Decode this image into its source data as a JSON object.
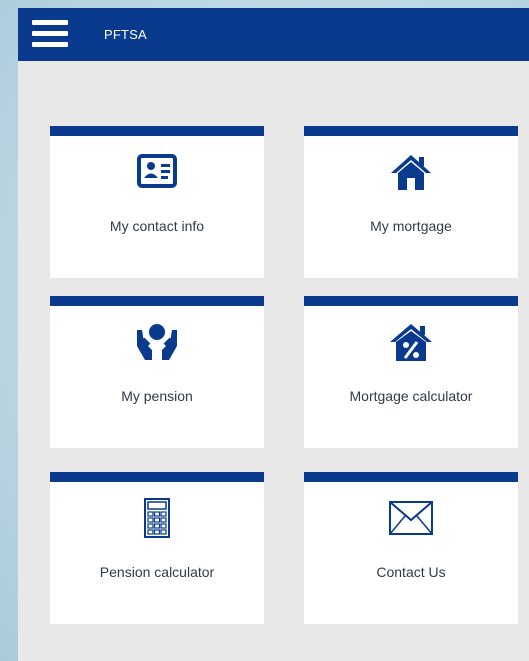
{
  "header": {
    "title": "PFTSA",
    "menu_icon": "hamburger-menu-icon"
  },
  "colors": {
    "brand": "#0a3a8e",
    "background": "#e8e8e8",
    "tile": "#ffffff",
    "text": "#333a44"
  },
  "tiles": [
    {
      "label": "My contact info",
      "icon": "contact-card-icon"
    },
    {
      "label": "My mortgage",
      "icon": "house-icon"
    },
    {
      "label": "My pension",
      "icon": "hands-coin-icon"
    },
    {
      "label": "Mortgage calculator",
      "icon": "house-percent-icon"
    },
    {
      "label": "Pension calculator",
      "icon": "calculator-icon"
    },
    {
      "label": "Contact Us",
      "icon": "envelope-icon"
    }
  ]
}
